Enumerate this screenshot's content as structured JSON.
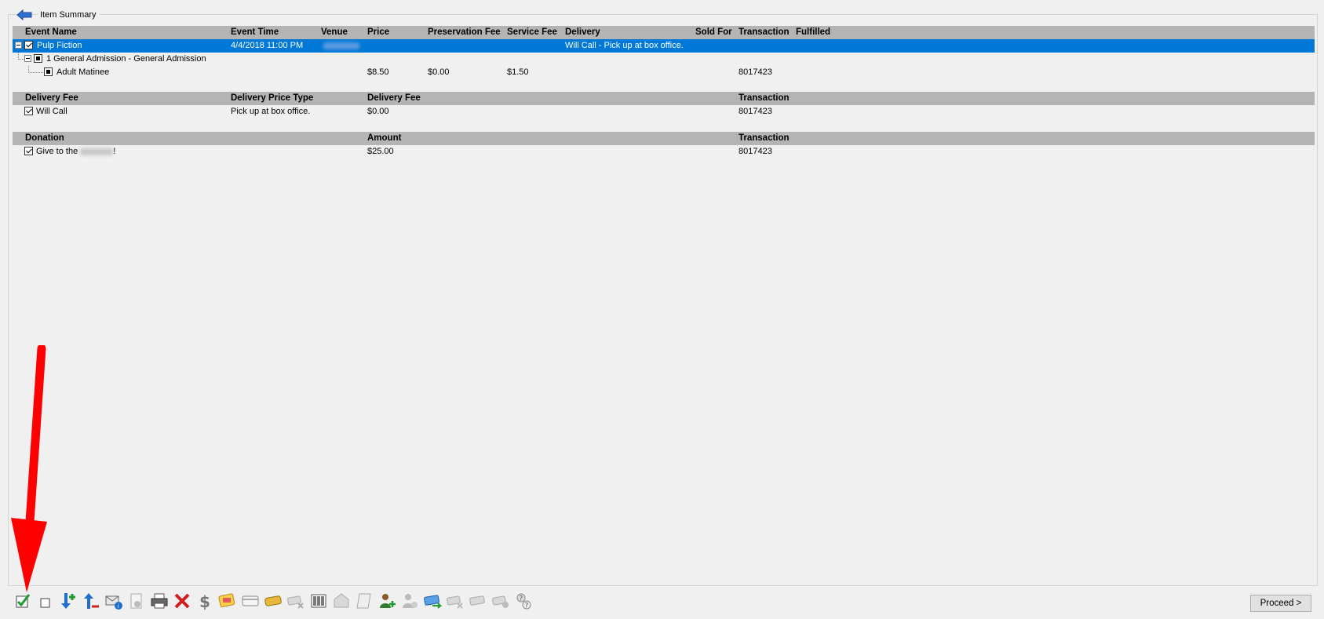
{
  "panel": {
    "title": "Item Summary"
  },
  "events_table": {
    "headers": [
      "Event Name",
      "Event Time",
      "Venue",
      "Price",
      "Preservation Fee",
      "Service Fee",
      "Delivery",
      "Sold For",
      "Transaction",
      "Fulfilled"
    ],
    "event": {
      "name": "Pulp Fiction",
      "time": "4/4/2018 11:00 PM",
      "delivery": "Will Call - Pick up at box office."
    },
    "admission": {
      "label": "1 General Admission - General Admission"
    },
    "ticket": {
      "name": "Adult Matinee",
      "price": "$8.50",
      "preservation_fee": "$0.00",
      "service_fee": "$1.50",
      "transaction": "8017423"
    }
  },
  "delivery_table": {
    "headers": [
      "Delivery Fee",
      "Delivery Price Type",
      "Delivery Fee",
      "Transaction"
    ],
    "row": {
      "name": "Will Call",
      "price_type": "Pick up at box office.",
      "fee": "$0.00",
      "transaction": "8017423"
    }
  },
  "donation_table": {
    "headers": [
      "Donation",
      "Amount",
      "Transaction"
    ],
    "row": {
      "prefix": "Give to the",
      "suffix": "!",
      "amount": "$25.00",
      "transaction": "8017423"
    }
  },
  "toolbar": {
    "icons": [
      "check-all-icon",
      "uncheck-all-icon",
      "move-down-add-icon",
      "move-up-remove-icon",
      "email-info-icon",
      "document-info-icon",
      "printer-icon",
      "delete-icon",
      "dollar-icon",
      "ticket-color-icon",
      "card-icon",
      "gold-ticket-icon",
      "ticket-cancel-icon",
      "barcode-icon",
      "envelope-icon",
      "scroll-icon",
      "user-add-icon",
      "user-disabled-icon",
      "ticket-exchange-icon",
      "ticket-remove-icon",
      "ticket-gray-icon",
      "ticket-info-icon",
      "help-icon"
    ],
    "proceed_label": "Proceed >"
  },
  "colors": {
    "selection": "#0078d7",
    "header_bg": "#b4b4b4",
    "arrow": "#ff0000"
  }
}
